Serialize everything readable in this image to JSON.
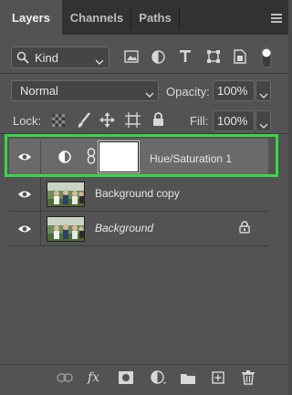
{
  "tabs": [
    {
      "label": "Layers",
      "active": true
    },
    {
      "label": "Channels",
      "active": false
    },
    {
      "label": "Paths",
      "active": false
    }
  ],
  "filter": {
    "kind_label": "Kind"
  },
  "blend": {
    "mode": "Normal",
    "opacity_label": "Opacity:",
    "opacity_value": "100%"
  },
  "lock": {
    "label": "Lock:",
    "fill_label": "Fill:",
    "fill_value": "100%"
  },
  "layers": [
    {
      "name": "Hue/Saturation 1",
      "type": "adjustment",
      "selected": true,
      "visible": true
    },
    {
      "name": "Background copy",
      "type": "image",
      "selected": false,
      "visible": true
    },
    {
      "name": "Background",
      "type": "image",
      "selected": false,
      "visible": true,
      "italic": true,
      "locked": true
    }
  ],
  "colors": {
    "highlight": "#39d64a",
    "panel": "#535353",
    "tabbar": "#323232"
  },
  "footer_icons": [
    "link-icon",
    "fx-icon",
    "mask-icon",
    "adjustment-icon",
    "folder-icon",
    "new-layer-icon",
    "trash-icon"
  ]
}
